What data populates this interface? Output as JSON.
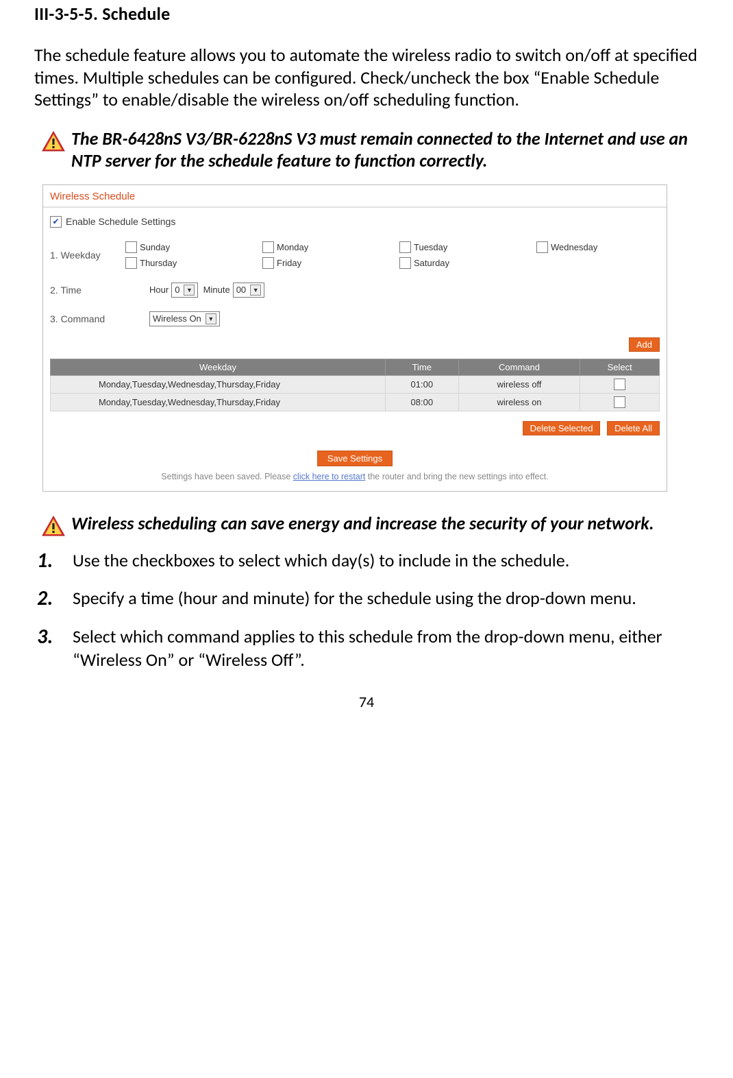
{
  "heading": "III-3-5-5.    Schedule",
  "intro": "The schedule feature allows you to automate the wireless radio to switch on/off at specified times. Multiple schedules can be configured. Check/uncheck the box “Enable Schedule Settings” to enable/disable the wireless on/off scheduling function.",
  "note1": "The BR-6428nS V3/BR-6228nS V3 must remain connected to the Internet and use an NTP server for the schedule feature to function correctly.",
  "note2": "Wireless scheduling can save energy and increase the security of your network.",
  "screenshot": {
    "title": "Wireless  Schedule",
    "enable_label": "Enable  Schedule Settings",
    "enable_checked": true,
    "row1_label": "1. Weekday",
    "days": [
      "Sunday",
      "Monday",
      "Tuesday",
      "Wednesday",
      "Thursday",
      "Friday",
      "Saturday"
    ],
    "row2_label": "2. Time",
    "hour_label": "Hour",
    "hour_value": "0",
    "minute_label": "Minute",
    "minute_value": "00",
    "row3_label": "3. Command",
    "command_value": "Wireless On",
    "add_label": "Add",
    "table": {
      "headers": [
        "Weekday",
        "Time",
        "Command",
        "Select"
      ],
      "rows": [
        {
          "weekday": "Monday,Tuesday,Wednesday,Thursday,Friday",
          "time": "01:00",
          "command": "wireless off"
        },
        {
          "weekday": "Monday,Tuesday,Wednesday,Thursday,Friday",
          "time": "08:00",
          "command": "wireless on"
        }
      ]
    },
    "delete_selected": "Delete Selected",
    "delete_all": "Delete All",
    "save_label": "Save Settings",
    "status_prefix": "Settings have been saved. Please ",
    "status_link": "click here to restart",
    "status_suffix": " the router and bring the new settings into effect."
  },
  "steps": [
    "Use the checkboxes to select which day(s) to include in the schedule.",
    "Specify a time (hour and minute) for the schedule using the drop-down menu.",
    "Select which command applies to this schedule from the drop-down menu, either “Wireless On” or “Wireless Off”."
  ],
  "page_number": "74"
}
